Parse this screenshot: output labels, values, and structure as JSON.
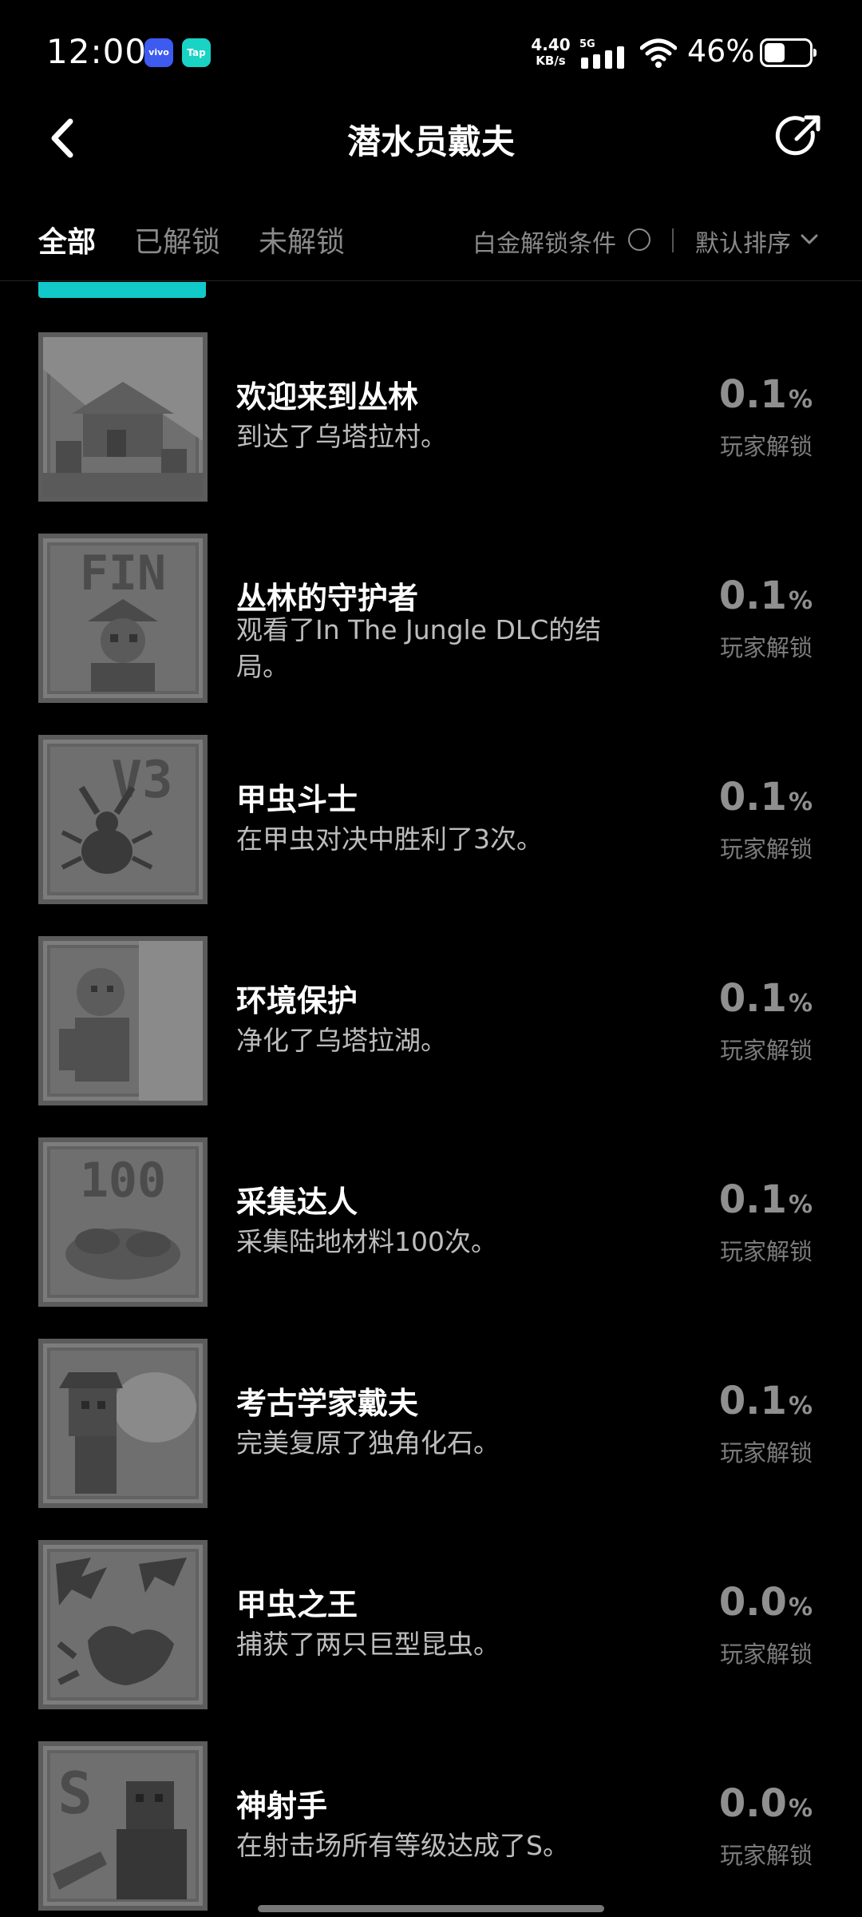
{
  "status_bar": {
    "time": "12:00",
    "badge_vivo": "vivo",
    "badge_tap": "Tap",
    "net_speed_value": "4.40",
    "net_speed_unit": "KB/s",
    "network_type": "5G",
    "battery_percent": "46%",
    "battery_level": 0.46
  },
  "header": {
    "back_icon": "chevron-left-icon",
    "title": "潜水员戴夫",
    "share_icon": "share-icon"
  },
  "filters": {
    "tabs": [
      {
        "label": "全部",
        "active": true
      },
      {
        "label": "已解锁",
        "active": false
      },
      {
        "label": "未解锁",
        "active": false
      }
    ],
    "platinum_condition_label": "白金解锁条件",
    "sort_label": "默认排序"
  },
  "achievements": [
    {
      "title": "欢迎来到丛林",
      "description": "到达了乌塔拉村。",
      "percent": "0.1",
      "percent_symbol": "%",
      "percent_caption": "玩家解锁",
      "icon": "village-icon"
    },
    {
      "title": "丛林的守护者",
      "description": "观看了In The Jungle DLC的结局。",
      "percent": "0.1",
      "percent_symbol": "%",
      "percent_caption": "玩家解锁",
      "icon": "fin-explorer-icon"
    },
    {
      "title": "甲虫斗士",
      "description": "在甲虫对决中胜利了3次。",
      "percent": "0.1",
      "percent_symbol": "%",
      "percent_caption": "玩家解锁",
      "icon": "beetle-v3-icon"
    },
    {
      "title": "环境保护",
      "description": "净化了乌塔拉湖。",
      "percent": "0.1",
      "percent_symbol": "%",
      "percent_caption": "玩家解锁",
      "icon": "old-man-icon"
    },
    {
      "title": "采集达人",
      "description": "采集陆地材料100次。",
      "percent": "0.1",
      "percent_symbol": "%",
      "percent_caption": "玩家解锁",
      "icon": "materials-100-icon"
    },
    {
      "title": "考古学家戴夫",
      "description": "完美复原了独角化石。",
      "percent": "0.1",
      "percent_symbol": "%",
      "percent_caption": "玩家解锁",
      "icon": "archaeologist-icon"
    },
    {
      "title": "甲虫之王",
      "description": "捕获了两只巨型昆虫。",
      "percent": "0.0",
      "percent_symbol": "%",
      "percent_caption": "玩家解锁",
      "icon": "giant-insects-icon"
    },
    {
      "title": "神射手",
      "description": "在射击场所有等级达成了S。",
      "percent": "0.0",
      "percent_symbol": "%",
      "percent_caption": "玩家解锁",
      "icon": "sharpshooter-s-icon"
    }
  ]
}
